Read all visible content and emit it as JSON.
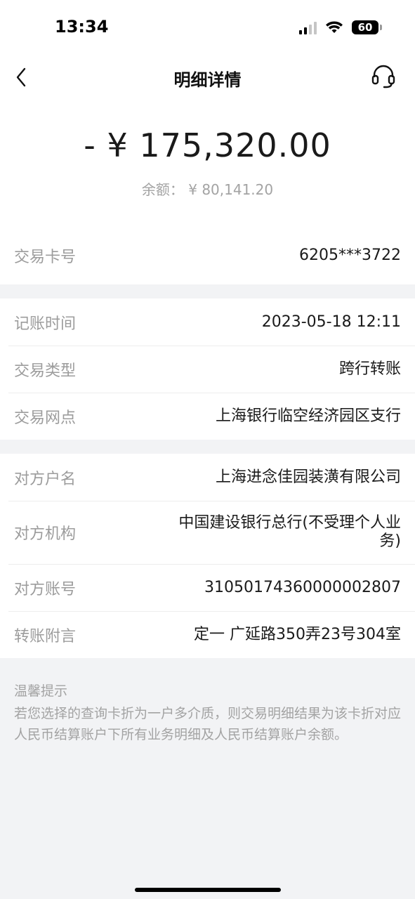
{
  "status": {
    "time": "13:34",
    "battery": "60"
  },
  "nav": {
    "title": "明细详情",
    "back_icon": "chevron-left-icon",
    "service_icon": "headset-icon"
  },
  "summary": {
    "amount": "- ¥ 175,320.00",
    "balance_label": "余额：",
    "balance_value": "¥ 80,141.20"
  },
  "sections": {
    "card": {
      "label": "交易卡号",
      "value": "6205***3722"
    },
    "transaction": {
      "time_label": "记账时间",
      "time_value": "2023-05-18 12:11",
      "type_label": "交易类型",
      "type_value": "跨行转账",
      "branch_label": "交易网点",
      "branch_value": "上海银行临空经济园区支行"
    },
    "counterparty": {
      "name_label": "对方户名",
      "name_value": "上海进念佳园装潢有限公司",
      "institution_label": "对方机构",
      "institution_value": "中国建设银行总行(不受理个人业务)",
      "account_label": "对方账号",
      "account_value": "31050174360000002807",
      "memo_label": "转账附言",
      "memo_value": "定一 广延路350弄23号304室"
    }
  },
  "tips": {
    "title": "温馨提示",
    "text": "若您选择的查询卡折为一户多介质，则交易明细结果为该卡折对应人民币结算账户下所有业务明细及人民币结算账户余额。"
  }
}
